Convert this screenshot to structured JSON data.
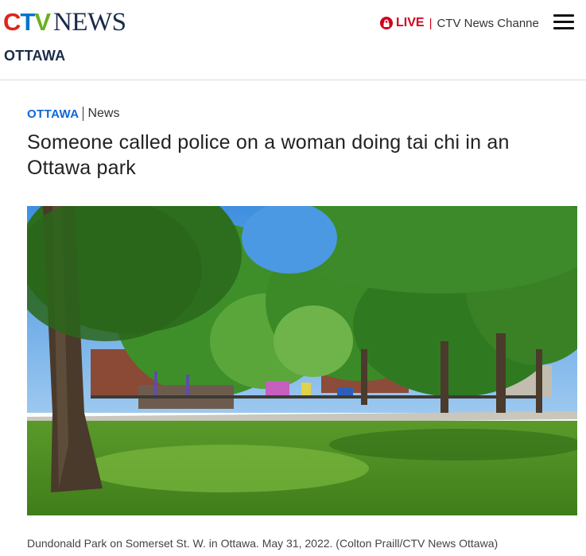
{
  "header": {
    "logo": {
      "c": "C",
      "t": "T",
      "v": "V",
      "news": "NEWS"
    },
    "live_label": "LIVE",
    "live_separator": "|",
    "live_channel": "CTV News Channe",
    "section": "OTTAWA",
    "menu_icon": "hamburger-icon"
  },
  "article": {
    "region": "OTTAWA",
    "category": "News",
    "headline": "Someone called police on a woman doing tai chi in an Ottawa park",
    "caption": "Dundonald Park on Somerset St. W. in Ottawa. May 31, 2022. (Colton Praill/CTV News Ottawa)"
  },
  "colors": {
    "brand_red": "#e2231a",
    "brand_blue": "#0073cf",
    "brand_green": "#6ab023",
    "navy": "#1b2b4a",
    "live_red": "#d0021b",
    "link_blue": "#0f66d6"
  }
}
